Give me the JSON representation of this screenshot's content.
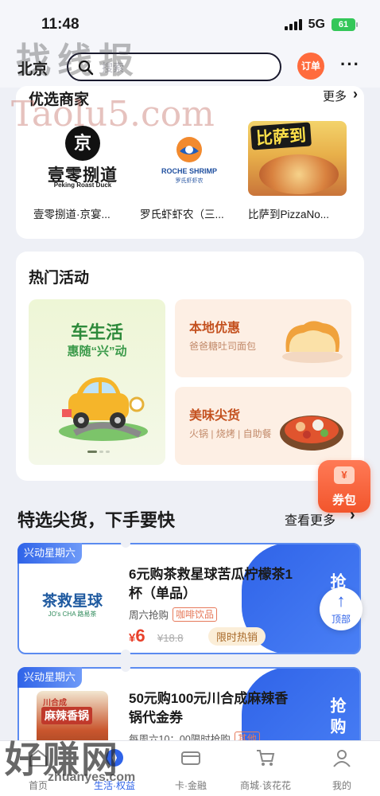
{
  "status_bar": {
    "time": "11:48",
    "network": "5G",
    "battery": "61"
  },
  "header": {
    "city": "北京",
    "search_placeholder": "搜索",
    "order_badge": "订单"
  },
  "watermark": {
    "top": "找线报",
    "url": "Taolu5.com",
    "bottom": "好赚网",
    "bottom_url": "zhuanyes.com"
  },
  "merchants": {
    "title": "优选商家",
    "more": "更多",
    "items": [
      {
        "name": "壹零捌道·京宴...",
        "logo_main": "壹零捌道",
        "logo_sub": "Peking Roast Duck",
        "logo_glyph": "京"
      },
      {
        "name": "罗氏虾虾农（三...",
        "logo_main": "ROCHE SHRIMP",
        "logo_sub": "罗氏虾虾农"
      },
      {
        "name": "比萨到PizzaNo...",
        "logo_main": "比萨到"
      }
    ]
  },
  "activities": {
    "title": "热门活动",
    "big": {
      "title": "车生活",
      "subtitle": "惠随“兴”动"
    },
    "small": [
      {
        "title": "本地优惠",
        "subtitle": "爸爸糖吐司面包"
      },
      {
        "title": "美味尖货",
        "subtitle": "火锅 | 烧烤 | 自助餐"
      }
    ]
  },
  "coupon_float": {
    "symbol": "¥",
    "label": "券包"
  },
  "selection": {
    "title": "特选尖货，下手要快",
    "more": "查看更多"
  },
  "deals": [
    {
      "tag": "兴动星期六",
      "logo_main": "茶救星球",
      "logo_sub": "JO's CHA  路易茶",
      "name": "6元购茶救星球苦瓜柠檬茶1杯（单品）",
      "when": "周六抢购",
      "category": "咖啡饮品",
      "currency": "¥",
      "price": "6",
      "orig_price": "¥18.8",
      "hot_label": "限时热销",
      "grab": "抢购"
    },
    {
      "tag": "兴动星期六",
      "logo_main": "麻辣香锅",
      "logo_sub": "川合成",
      "name": "50元购100元川合成麻辣香锅代金券",
      "when": "每周六10：00限时抢购",
      "category": "其他",
      "grab": "抢购"
    }
  ],
  "back_to_top": {
    "arrow": "↑",
    "label": "顶部"
  },
  "nav": [
    {
      "label": "首页",
      "icon": "home-icon"
    },
    {
      "label": "生活·权益",
      "icon": "compass-icon",
      "active": true
    },
    {
      "label": "卡·金融",
      "icon": "card-icon"
    },
    {
      "label": "商城·该花花",
      "icon": "cart-icon"
    },
    {
      "label": "我的",
      "icon": "person-icon"
    }
  ]
}
